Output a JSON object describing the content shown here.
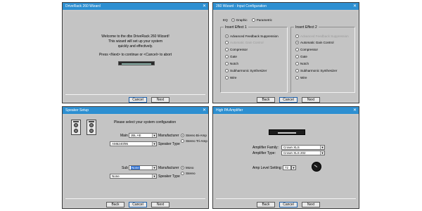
{
  "welcome": {
    "title": "DriveRack 260 Wizard",
    "lines": [
      "Welcome to the dbx DriveRack 260 Wizard!",
      "This wizard will set up your system",
      "quickly and effectively.",
      "Press <Next> to continue or <Cancel> to abort"
    ],
    "cancel": "Cancel",
    "next": "Next"
  },
  "input_config": {
    "title": "260 Wizard - Input Configuration",
    "mode_eq": "EQ",
    "mode_graphic": "Graphic",
    "mode_parametric": "Parametric",
    "effect1_label": "Insert Effect 1",
    "effect1_options": [
      "Advanced Feedback Suppression",
      "Automatic Gain Control",
      "Compressor",
      "Gate",
      "Notch",
      "Subharmonic Synthesizer",
      "Wire"
    ],
    "effect2_label": "Insert Effect 2",
    "effect2_options": [
      "Advanced Feedback Suppression",
      "Automatic Gain Control",
      "Compressor",
      "Gate",
      "Notch",
      "Subharmonic Synthesizer",
      "Wire"
    ],
    "back": "Back",
    "cancel": "Cancel",
    "next": "Next"
  },
  "speaker_setup": {
    "title": "Speaker Setup",
    "prompt": "Please select your system configuration",
    "main_label": "Main",
    "main_manufacturer": "JBL AE",
    "manufacturer_label": "Manufacturer",
    "main_type": "AM6240/95",
    "speaker_type_label": "Speaker Type",
    "stereo_biamp": "Stereo Bi-Amp",
    "stereo_triamp": "Stereo Tri-Amp",
    "sub_label": "Sub",
    "sub_manufacturer": "None",
    "sub_type": "None",
    "mono": "Mono",
    "stereo": "Stereo",
    "back": "Back",
    "cancel": "Cancel",
    "next": "Next"
  },
  "amplifier": {
    "title": "High PA Amplifier",
    "family_label": "Amplifier Family:",
    "family_value": "Crown XLS",
    "type_label": "Amplifier Type:",
    "type_value": "Crown XLS 202",
    "level_label": "Amp Level Setting:",
    "level_value": "72",
    "back": "Back",
    "cancel": "Cancel",
    "next": "Next"
  }
}
